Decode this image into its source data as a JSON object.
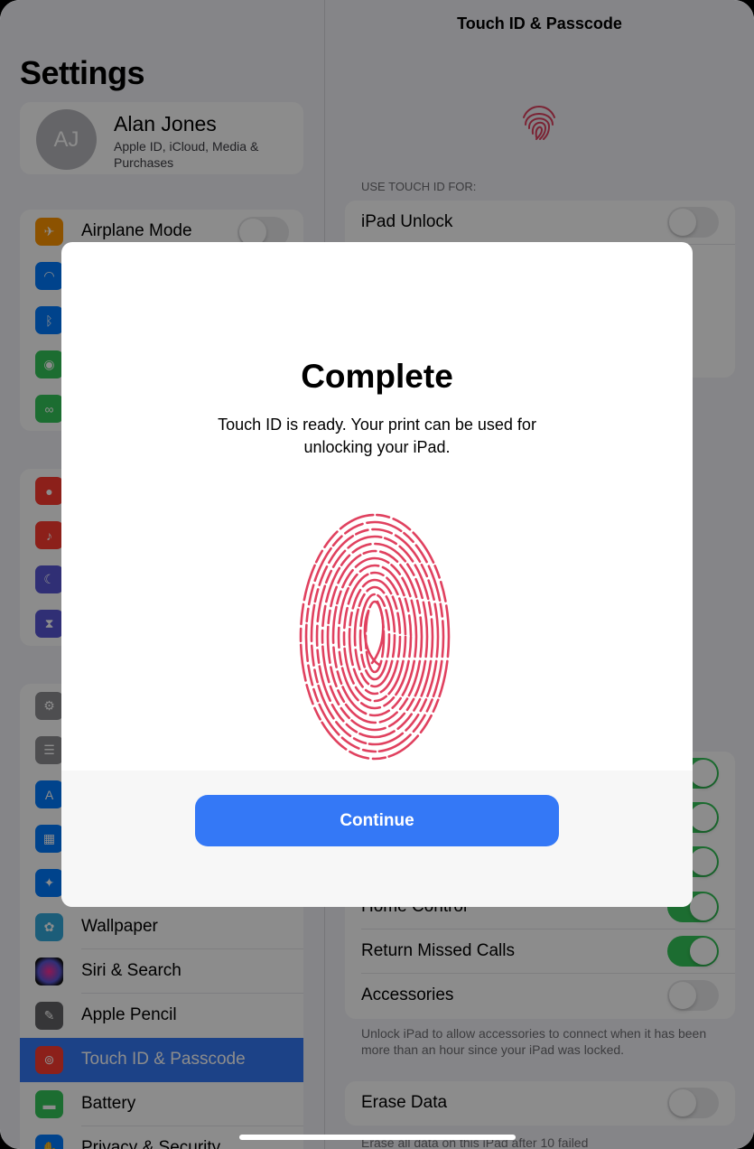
{
  "sidebar": {
    "title": "Settings",
    "profile": {
      "initials": "AJ",
      "name": "Alan Jones",
      "subtitle": "Apple ID, iCloud, Media & Purchases"
    },
    "items": [
      {
        "label": "Airplane Mode",
        "icon": "airplane-icon",
        "color": "#ff9500"
      },
      {
        "label": "",
        "icon": "wifi-icon",
        "color": "#007aff"
      },
      {
        "label": "",
        "icon": "bluetooth-icon",
        "color": "#007aff"
      },
      {
        "label": "",
        "icon": "cellular-icon",
        "color": "#34c759"
      },
      {
        "label": "",
        "icon": "personal-hotspot-icon",
        "color": "#34c759"
      },
      {
        "label": "",
        "icon": "notifications-icon",
        "color": "#ff3b30"
      },
      {
        "label": "",
        "icon": "sounds-icon",
        "color": "#ff3b30"
      },
      {
        "label": "",
        "icon": "focus-icon",
        "color": "#5856d6"
      },
      {
        "label": "",
        "icon": "screen-time-icon",
        "color": "#5856d6"
      },
      {
        "label": "",
        "icon": "general-icon",
        "color": "#8e8e93"
      },
      {
        "label": "",
        "icon": "control-center-icon",
        "color": "#8e8e93"
      },
      {
        "label": "",
        "icon": "display-icon",
        "color": "#007aff"
      },
      {
        "label": "",
        "icon": "home-screen-icon",
        "color": "#007aff"
      },
      {
        "label": "",
        "icon": "accessibility-icon",
        "color": "#007aff"
      },
      {
        "label": "Wallpaper",
        "icon": "wallpaper-icon",
        "color": "#34aadc"
      },
      {
        "label": "Siri & Search",
        "icon": "siri-icon",
        "color": "#222222"
      },
      {
        "label": "Apple Pencil",
        "icon": "pencil-icon",
        "color": "#636366"
      },
      {
        "label": "Touch ID & Passcode",
        "icon": "touch-id-icon",
        "color": "#ff3b30"
      },
      {
        "label": "Battery",
        "icon": "battery-icon",
        "color": "#34c759"
      },
      {
        "label": "Privacy & Security",
        "icon": "privacy-icon",
        "color": "#007aff"
      }
    ]
  },
  "detail": {
    "title": "Touch ID & Passcode",
    "use_touch_id_header": "USE TOUCH ID FOR:",
    "rows": [
      {
        "label": "iPad Unlock",
        "on": false
      },
      {
        "label": "Home Control",
        "on": true
      },
      {
        "label": "Return Missed Calls",
        "on": true
      },
      {
        "label": "Accessories",
        "on": false
      }
    ],
    "accessories_note": "Unlock iPad to allow accessories to connect when it has been more than an hour since your iPad was locked.",
    "erase_label": "Erase Data",
    "erase_note": "Erase all data on this iPad after 10 failed"
  },
  "modal": {
    "title": "Complete",
    "body": "Touch ID is ready. Your print can be used for unlocking your iPad.",
    "continue_label": "Continue",
    "accent_color": "#3478f6",
    "fingerprint_color": "#e0415f"
  }
}
